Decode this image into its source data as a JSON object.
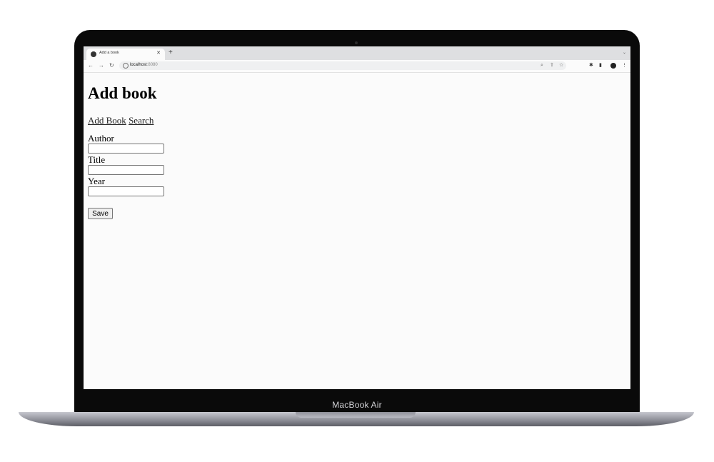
{
  "device": {
    "brand_label": "MacBook Air"
  },
  "browser": {
    "tab_title": "Add a book",
    "url_host": "localhost",
    "url_port": ":8080"
  },
  "page": {
    "heading": "Add book",
    "nav": {
      "add_book": "Add Book",
      "search": "Search"
    },
    "form": {
      "author_label": "Author",
      "author_value": "",
      "title_label": "Title",
      "title_value": "",
      "year_label": "Year",
      "year_value": "",
      "save_label": "Save"
    }
  }
}
